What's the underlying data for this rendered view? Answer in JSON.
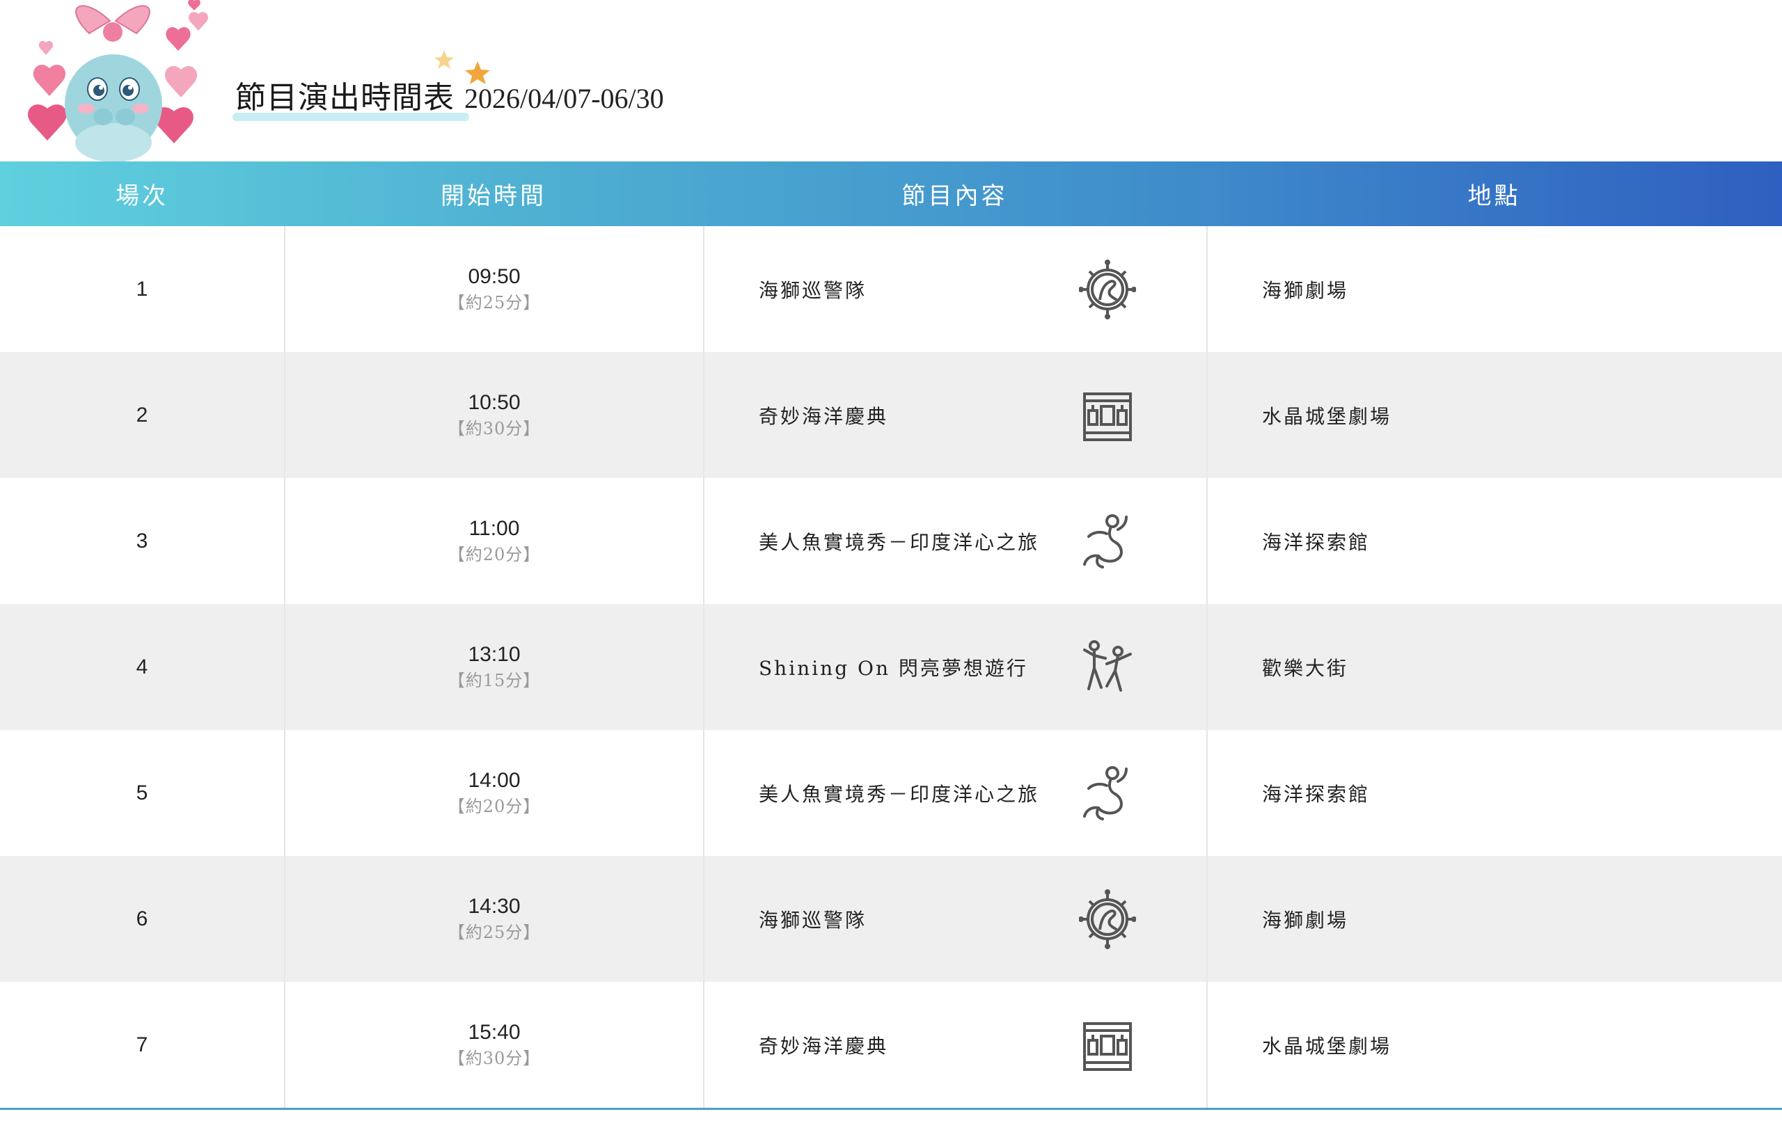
{
  "header": {
    "title": "節目演出時間表",
    "date_range": "2026/04/07-06/30"
  },
  "table": {
    "columns": [
      "場次",
      "開始時間",
      "節目內容",
      "地點"
    ],
    "rows": [
      {
        "no": "1",
        "time": "09:50",
        "duration": "【約25分】",
        "show": "海獅巡警隊",
        "icon": "sea-lion-wheel-icon",
        "place": "海獅劇場"
      },
      {
        "no": "2",
        "time": "10:50",
        "duration": "【約30分】",
        "show": "奇妙海洋慶典",
        "icon": "castle-stage-icon",
        "place": "水晶城堡劇場"
      },
      {
        "no": "3",
        "time": "11:00",
        "duration": "【約20分】",
        "show": "美人魚實境秀－印度洋心之旅",
        "icon": "mermaid-icon",
        "place": "海洋探索館"
      },
      {
        "no": "4",
        "time": "13:10",
        "duration": "【約15分】",
        "show": "Shining On 閃亮夢想遊行",
        "icon": "dancers-icon",
        "place": "歡樂大街"
      },
      {
        "no": "5",
        "time": "14:00",
        "duration": "【約20分】",
        "show": "美人魚實境秀－印度洋心之旅",
        "icon": "mermaid-icon",
        "place": "海洋探索館"
      },
      {
        "no": "6",
        "time": "14:30",
        "duration": "【約25分】",
        "show": "海獅巡警隊",
        "icon": "sea-lion-wheel-icon",
        "place": "海獅劇場"
      },
      {
        "no": "7",
        "time": "15:40",
        "duration": "【約30分】",
        "show": "奇妙海洋慶典",
        "icon": "castle-stage-icon",
        "place": "水晶城堡劇場"
      }
    ]
  },
  "colors": {
    "header_gradient_start": "#5fd0de",
    "header_gradient_end": "#2f5fc0",
    "alt_row": "#efefef",
    "duration_text": "#9a9a9a",
    "icon_stroke": "#555555"
  }
}
